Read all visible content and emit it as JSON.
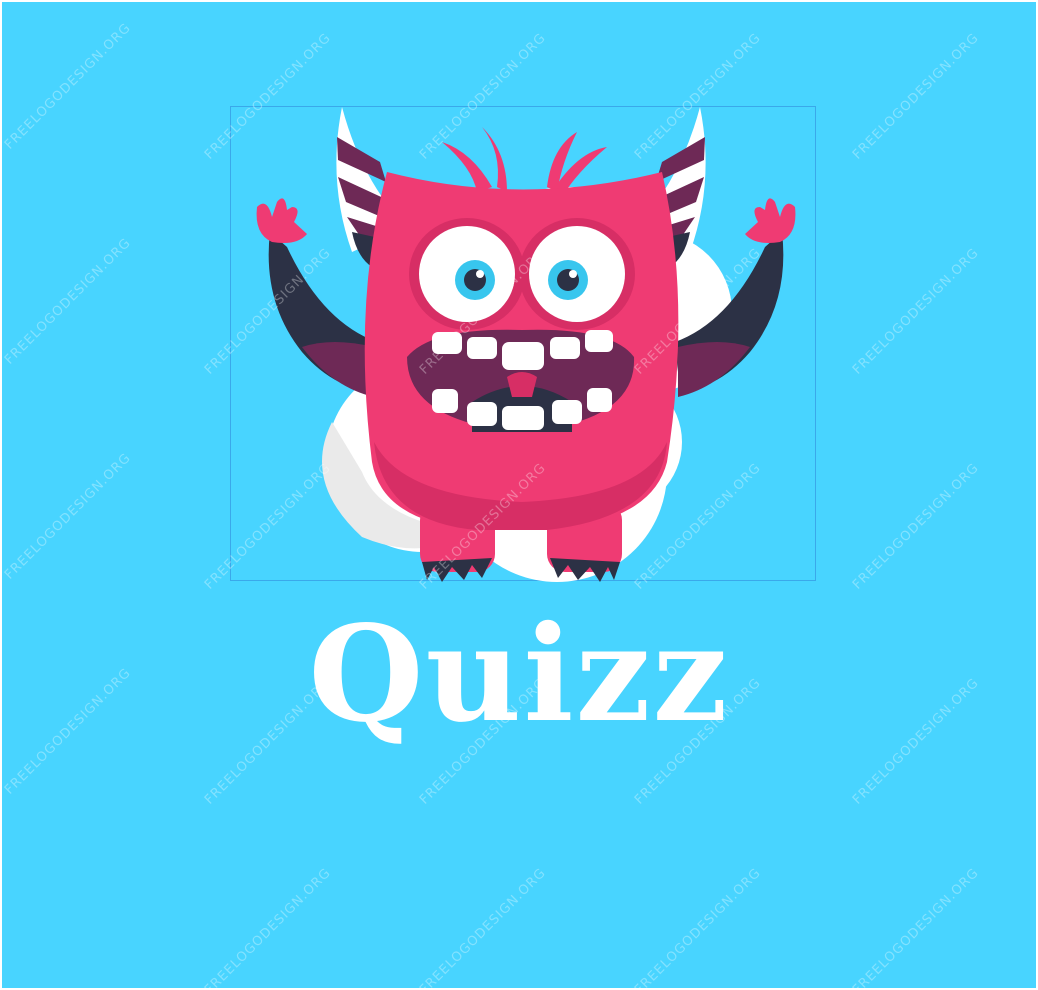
{
  "logo": {
    "title": "Quizz",
    "background_color": "#48d4ff",
    "mascot": "pink-horned-monster-icon",
    "watermark": "FREELOGODESIGN.ORG"
  }
}
